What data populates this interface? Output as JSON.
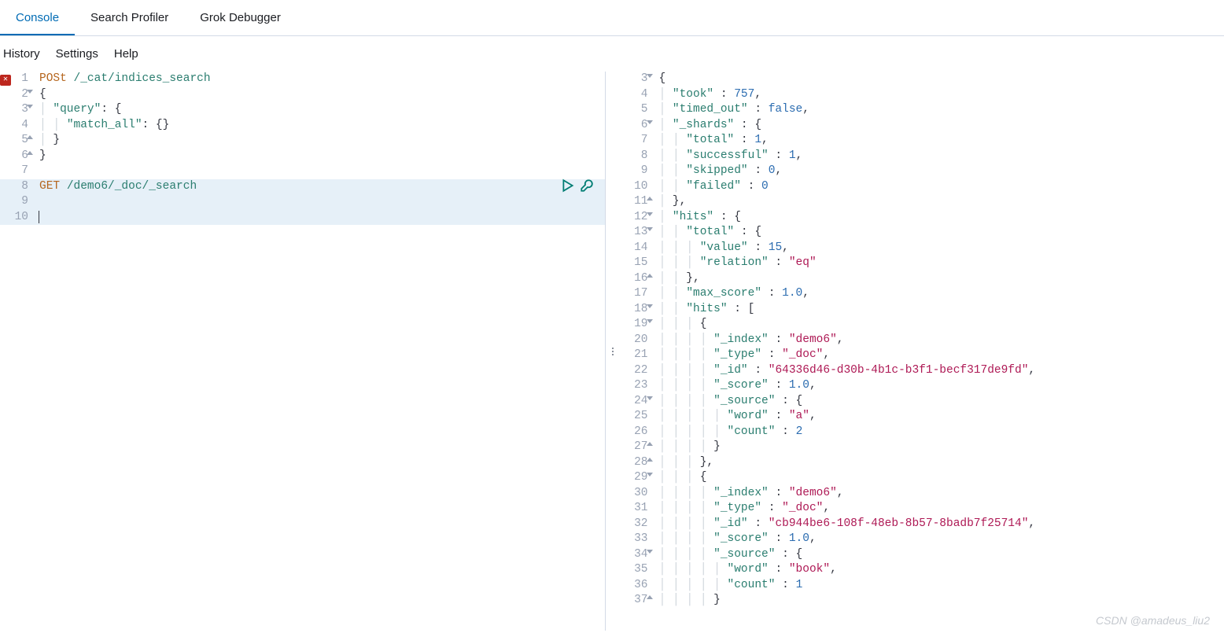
{
  "tabs": [
    {
      "label": "Console",
      "active": true
    },
    {
      "label": "Search Profiler",
      "active": false
    },
    {
      "label": "Grok Debugger",
      "active": false
    }
  ],
  "subtabs": [
    "History",
    "Settings",
    "Help"
  ],
  "editor": {
    "lines": [
      {
        "num": 1,
        "err": true,
        "tokens": [
          [
            "kw1",
            "POSt"
          ],
          [
            "punc",
            " "
          ],
          [
            "path",
            "/_cat/indices_search"
          ]
        ]
      },
      {
        "num": 2,
        "fold": "open",
        "tokens": [
          [
            "punc",
            "{"
          ]
        ]
      },
      {
        "num": 3,
        "fold": "open",
        "tokens": [
          [
            "punc",
            "  "
          ],
          [
            "key",
            "\"query\""
          ],
          [
            "punc",
            ": {"
          ]
        ]
      },
      {
        "num": 4,
        "tokens": [
          [
            "punc",
            "    "
          ],
          [
            "key",
            "\"match_all\""
          ],
          [
            "punc",
            ": {}"
          ]
        ]
      },
      {
        "num": 5,
        "fold": "close",
        "tokens": [
          [
            "punc",
            "  }"
          ]
        ]
      },
      {
        "num": 6,
        "fold": "close",
        "tokens": [
          [
            "punc",
            "}"
          ]
        ]
      },
      {
        "num": 7,
        "tokens": []
      },
      {
        "num": 8,
        "actions": true,
        "hl": true,
        "tokens": [
          [
            "kw1",
            "GET"
          ],
          [
            "punc",
            " "
          ],
          [
            "path",
            "/demo6/_doc/_search"
          ]
        ]
      },
      {
        "num": 9,
        "hl": true,
        "tokens": []
      },
      {
        "num": 10,
        "hl": true,
        "cursor": true,
        "tokens": []
      }
    ]
  },
  "response": {
    "lines": [
      {
        "num": 3,
        "fold": "open",
        "tokens": [
          [
            "punc",
            "{"
          ]
        ]
      },
      {
        "num": 4,
        "tokens": [
          [
            "punc",
            "  "
          ],
          [
            "key",
            "\"took\""
          ],
          [
            "punc",
            " : "
          ],
          [
            "num",
            "757"
          ],
          [
            "punc",
            ","
          ]
        ]
      },
      {
        "num": 5,
        "tokens": [
          [
            "punc",
            "  "
          ],
          [
            "key",
            "\"timed_out\""
          ],
          [
            "punc",
            " : "
          ],
          [
            "bool",
            "false"
          ],
          [
            "punc",
            ","
          ]
        ]
      },
      {
        "num": 6,
        "fold": "open",
        "tokens": [
          [
            "punc",
            "  "
          ],
          [
            "key",
            "\"_shards\""
          ],
          [
            "punc",
            " : {"
          ]
        ]
      },
      {
        "num": 7,
        "tokens": [
          [
            "punc",
            "    "
          ],
          [
            "key",
            "\"total\""
          ],
          [
            "punc",
            " : "
          ],
          [
            "num",
            "1"
          ],
          [
            "punc",
            ","
          ]
        ]
      },
      {
        "num": 8,
        "tokens": [
          [
            "punc",
            "    "
          ],
          [
            "key",
            "\"successful\""
          ],
          [
            "punc",
            " : "
          ],
          [
            "num",
            "1"
          ],
          [
            "punc",
            ","
          ]
        ]
      },
      {
        "num": 9,
        "tokens": [
          [
            "punc",
            "    "
          ],
          [
            "key",
            "\"skipped\""
          ],
          [
            "punc",
            " : "
          ],
          [
            "num",
            "0"
          ],
          [
            "punc",
            ","
          ]
        ]
      },
      {
        "num": 10,
        "tokens": [
          [
            "punc",
            "    "
          ],
          [
            "key",
            "\"failed\""
          ],
          [
            "punc",
            " : "
          ],
          [
            "num",
            "0"
          ]
        ]
      },
      {
        "num": 11,
        "fold": "close",
        "tokens": [
          [
            "punc",
            "  },"
          ]
        ]
      },
      {
        "num": 12,
        "fold": "open",
        "tokens": [
          [
            "punc",
            "  "
          ],
          [
            "key",
            "\"hits\""
          ],
          [
            "punc",
            " : {"
          ]
        ]
      },
      {
        "num": 13,
        "fold": "open",
        "tokens": [
          [
            "punc",
            "    "
          ],
          [
            "key",
            "\"total\""
          ],
          [
            "punc",
            " : {"
          ]
        ]
      },
      {
        "num": 14,
        "tokens": [
          [
            "punc",
            "      "
          ],
          [
            "key",
            "\"value\""
          ],
          [
            "punc",
            " : "
          ],
          [
            "num",
            "15"
          ],
          [
            "punc",
            ","
          ]
        ]
      },
      {
        "num": 15,
        "tokens": [
          [
            "punc",
            "      "
          ],
          [
            "key",
            "\"relation\""
          ],
          [
            "punc",
            " : "
          ],
          [
            "str",
            "\"eq\""
          ]
        ]
      },
      {
        "num": 16,
        "fold": "close",
        "tokens": [
          [
            "punc",
            "    },"
          ]
        ]
      },
      {
        "num": 17,
        "tokens": [
          [
            "punc",
            "    "
          ],
          [
            "key",
            "\"max_score\""
          ],
          [
            "punc",
            " : "
          ],
          [
            "num",
            "1.0"
          ],
          [
            "punc",
            ","
          ]
        ]
      },
      {
        "num": 18,
        "fold": "open",
        "tokens": [
          [
            "punc",
            "    "
          ],
          [
            "key",
            "\"hits\""
          ],
          [
            "punc",
            " : ["
          ]
        ]
      },
      {
        "num": 19,
        "fold": "open",
        "tokens": [
          [
            "punc",
            "      {"
          ]
        ]
      },
      {
        "num": 20,
        "tokens": [
          [
            "punc",
            "        "
          ],
          [
            "key",
            "\"_index\""
          ],
          [
            "punc",
            " : "
          ],
          [
            "str",
            "\"demo6\""
          ],
          [
            "punc",
            ","
          ]
        ]
      },
      {
        "num": 21,
        "tokens": [
          [
            "punc",
            "        "
          ],
          [
            "key",
            "\"_type\""
          ],
          [
            "punc",
            " : "
          ],
          [
            "str",
            "\"_doc\""
          ],
          [
            "punc",
            ","
          ]
        ]
      },
      {
        "num": 22,
        "tokens": [
          [
            "punc",
            "        "
          ],
          [
            "key",
            "\"_id\""
          ],
          [
            "punc",
            " : "
          ],
          [
            "str",
            "\"64336d46-d30b-4b1c-b3f1-becf317de9fd\""
          ],
          [
            "punc",
            ","
          ]
        ]
      },
      {
        "num": 23,
        "tokens": [
          [
            "punc",
            "        "
          ],
          [
            "key",
            "\"_score\""
          ],
          [
            "punc",
            " : "
          ],
          [
            "num",
            "1.0"
          ],
          [
            "punc",
            ","
          ]
        ]
      },
      {
        "num": 24,
        "fold": "open",
        "tokens": [
          [
            "punc",
            "        "
          ],
          [
            "key",
            "\"_source\""
          ],
          [
            "punc",
            " : {"
          ]
        ]
      },
      {
        "num": 25,
        "tokens": [
          [
            "punc",
            "          "
          ],
          [
            "key",
            "\"word\""
          ],
          [
            "punc",
            " : "
          ],
          [
            "str",
            "\"a\""
          ],
          [
            "punc",
            ","
          ]
        ]
      },
      {
        "num": 26,
        "tokens": [
          [
            "punc",
            "          "
          ],
          [
            "key",
            "\"count\""
          ],
          [
            "punc",
            " : "
          ],
          [
            "num",
            "2"
          ]
        ]
      },
      {
        "num": 27,
        "fold": "close",
        "tokens": [
          [
            "punc",
            "        }"
          ]
        ]
      },
      {
        "num": 28,
        "fold": "close",
        "tokens": [
          [
            "punc",
            "      },"
          ]
        ]
      },
      {
        "num": 29,
        "fold": "open",
        "tokens": [
          [
            "punc",
            "      {"
          ]
        ]
      },
      {
        "num": 30,
        "tokens": [
          [
            "punc",
            "        "
          ],
          [
            "key",
            "\"_index\""
          ],
          [
            "punc",
            " : "
          ],
          [
            "str",
            "\"demo6\""
          ],
          [
            "punc",
            ","
          ]
        ]
      },
      {
        "num": 31,
        "tokens": [
          [
            "punc",
            "        "
          ],
          [
            "key",
            "\"_type\""
          ],
          [
            "punc",
            " : "
          ],
          [
            "str",
            "\"_doc\""
          ],
          [
            "punc",
            ","
          ]
        ]
      },
      {
        "num": 32,
        "tokens": [
          [
            "punc",
            "        "
          ],
          [
            "key",
            "\"_id\""
          ],
          [
            "punc",
            " : "
          ],
          [
            "str",
            "\"cb944be6-108f-48eb-8b57-8badb7f25714\""
          ],
          [
            "punc",
            ","
          ]
        ]
      },
      {
        "num": 33,
        "tokens": [
          [
            "punc",
            "        "
          ],
          [
            "key",
            "\"_score\""
          ],
          [
            "punc",
            " : "
          ],
          [
            "num",
            "1.0"
          ],
          [
            "punc",
            ","
          ]
        ]
      },
      {
        "num": 34,
        "fold": "open",
        "tokens": [
          [
            "punc",
            "        "
          ],
          [
            "key",
            "\"_source\""
          ],
          [
            "punc",
            " : {"
          ]
        ]
      },
      {
        "num": 35,
        "tokens": [
          [
            "punc",
            "          "
          ],
          [
            "key",
            "\"word\""
          ],
          [
            "punc",
            " : "
          ],
          [
            "str",
            "\"book\""
          ],
          [
            "punc",
            ","
          ]
        ]
      },
      {
        "num": 36,
        "tokens": [
          [
            "punc",
            "          "
          ],
          [
            "key",
            "\"count\""
          ],
          [
            "punc",
            " : "
          ],
          [
            "num",
            "1"
          ]
        ]
      },
      {
        "num": 37,
        "fold": "close",
        "tokens": [
          [
            "punc",
            "        }"
          ]
        ]
      }
    ]
  },
  "watermark": "CSDN @amadeus_liu2"
}
